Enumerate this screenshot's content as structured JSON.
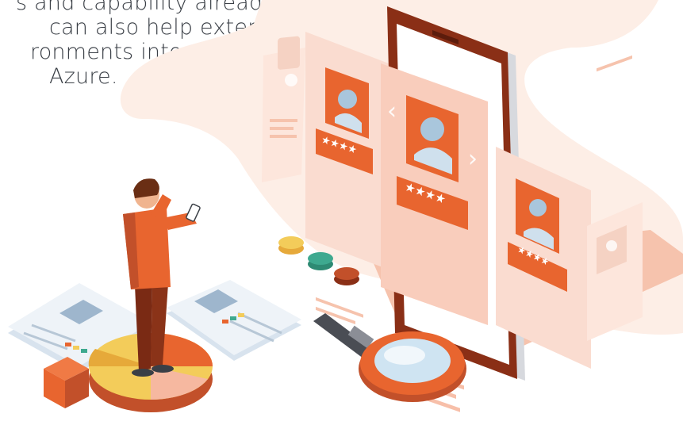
{
  "caption": {
    "lines": [
      "s and capability already in",
      "can also help extend",
      "ronments into",
      "Azure."
    ]
  },
  "colors": {
    "blob": "#fdeee6",
    "accent": "#e8652f",
    "accent_light": "#f6b8a0",
    "phone_frame": "#8a2f16",
    "card": "#fbe1d6",
    "yellow": "#f3cc5a",
    "teal": "#3ea98f",
    "text": "#3a3f46"
  },
  "icons": [
    "person-with-phone-icon",
    "phone-icon",
    "profile-card-icon",
    "star-rating-icon",
    "magnifying-glass-icon",
    "pie-chart-icon",
    "document-icon",
    "cube-icon",
    "toggle-button-icon"
  ]
}
